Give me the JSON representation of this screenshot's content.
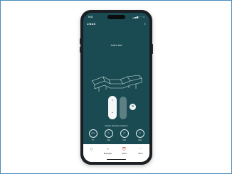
{
  "status_bar": {
    "time": "9:41",
    "icons": "▂▄▆ ◠ ▭"
  },
  "app": {
    "logo": "LINAK"
  },
  "bed": {
    "name": "Julie's bed"
  },
  "controls": {
    "up_glyph": "⌃",
    "down_glyph": "⌄",
    "flat_glyph": "≋"
  },
  "favourites": {
    "label": "Delete favorite positions",
    "items": [
      {
        "icon": "tv-icon",
        "glyph": "▭",
        "label": "TV"
      },
      {
        "icon": "star-icon",
        "glyph": "☆",
        "label": "Add"
      },
      {
        "icon": "star-icon",
        "glyph": "☆",
        "label": "Add"
      },
      {
        "icon": "star-icon",
        "glyph": "☆",
        "label": "Add"
      }
    ]
  },
  "nav": [
    {
      "icon": "remote-icon",
      "glyph": "▯",
      "label": ""
    },
    {
      "icon": "massage-icon",
      "glyph": "≈",
      "label": "Massage"
    },
    {
      "icon": "alarm-icon",
      "glyph": "⏰",
      "label": "Alarm"
    },
    {
      "icon": "more-icon",
      "glyph": "⋯",
      "label": "More"
    }
  ]
}
